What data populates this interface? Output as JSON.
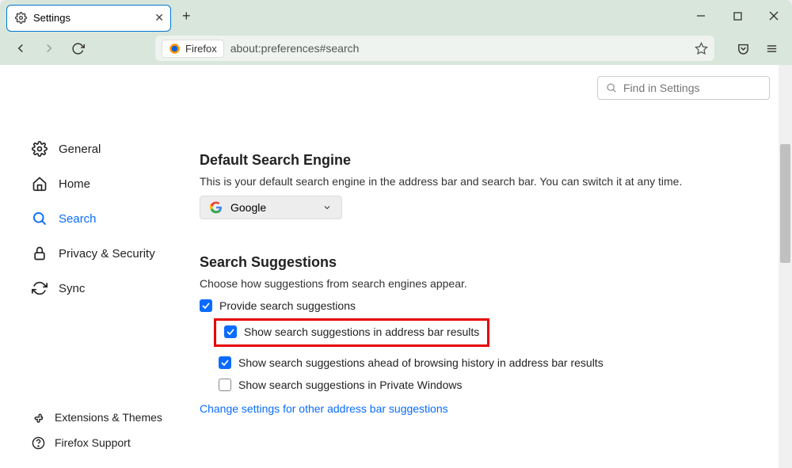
{
  "window": {
    "tab_title": "Settings"
  },
  "toolbar": {
    "identity_label": "Firefox",
    "url": "about:preferences#search"
  },
  "sidebar": {
    "items": [
      {
        "label": "General"
      },
      {
        "label": "Home"
      },
      {
        "label": "Search"
      },
      {
        "label": "Privacy & Security"
      },
      {
        "label": "Sync"
      }
    ],
    "bottom": [
      {
        "label": "Extensions & Themes"
      },
      {
        "label": "Firefox Support"
      }
    ]
  },
  "find": {
    "placeholder": "Find in Settings"
  },
  "default_engine": {
    "title": "Default Search Engine",
    "desc": "This is your default search engine in the address bar and search bar. You can switch it at any time.",
    "selected": "Google"
  },
  "suggestions": {
    "title": "Search Suggestions",
    "desc": "Choose how suggestions from search engines appear.",
    "chk_provide": "Provide search suggestions",
    "chk_addressbar": "Show search suggestions in address bar results",
    "chk_ahead": "Show search suggestions ahead of browsing history in address bar results",
    "chk_private": "Show search suggestions in Private Windows",
    "link": "Change settings for other address bar suggestions"
  }
}
